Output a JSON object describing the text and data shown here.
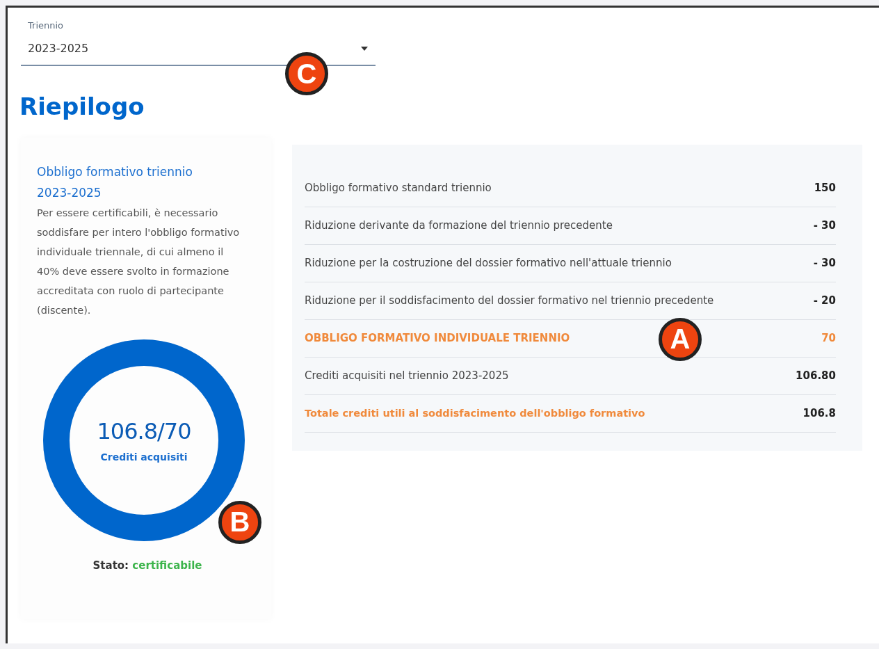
{
  "period_select": {
    "label": "Triennio",
    "value": "2023-2025"
  },
  "heading": "Riepilogo",
  "obligation_card": {
    "title": "Obbligo formativo triennio 2023-2025",
    "description": "Per essere certificabili, è necessario soddisfare per intero l'obbligo formativo individuale triennale, di cui almeno il 40% deve essere svolto in formazione accreditata con ruolo di partecipante (discente).",
    "progress": {
      "value": "106.8/70",
      "caption": "Crediti acquisiti",
      "level": 1
    },
    "status_label": "Stato:",
    "status_value": "certificabile"
  },
  "summary_rows": [
    {
      "label": "Obbligo formativo standard triennio",
      "value": "150",
      "kind": "normal"
    },
    {
      "label": "Riduzione derivante da formazione del triennio precedente",
      "value": "- 30",
      "kind": "normal"
    },
    {
      "label": "Riduzione per la costruzione del dossier formativo nell'attuale triennio",
      "value": "- 30",
      "kind": "normal"
    },
    {
      "label": "Riduzione per il soddisfacimento del dossier formativo nel triennio precedente",
      "value": "- 20",
      "kind": "normal"
    },
    {
      "label": "OBBLIGO FORMATIVO INDIVIDUALE TRIENNIO",
      "value": "70",
      "kind": "highlight"
    },
    {
      "label": "Crediti acquisiti nel triennio 2023-2025",
      "value": "106.80",
      "kind": "normal"
    },
    {
      "label": "Totale crediti utili al soddisfacimento dell'obbligo formativo",
      "value": "106.8",
      "kind": "total"
    }
  ],
  "callouts": [
    {
      "letter": "C"
    },
    {
      "letter": "A"
    },
    {
      "letter": "B"
    }
  ]
}
